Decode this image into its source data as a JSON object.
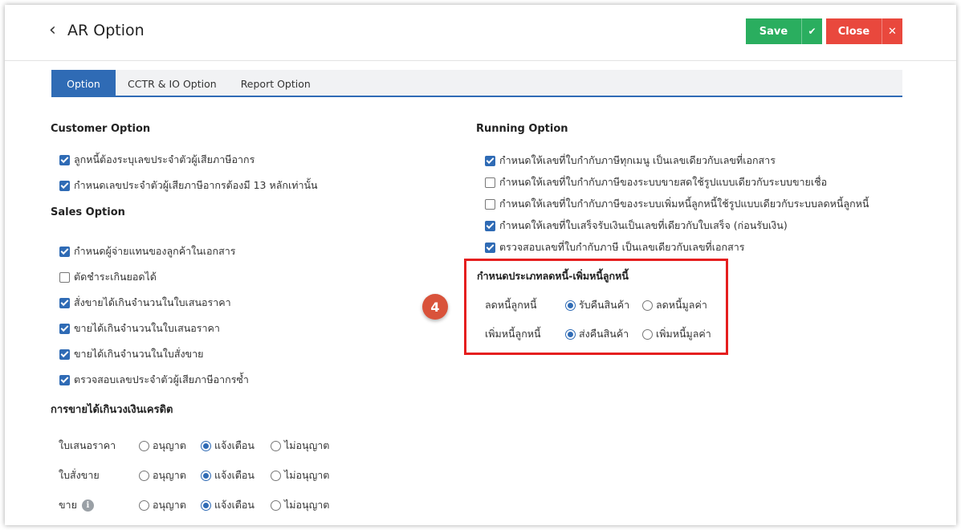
{
  "header": {
    "title": "AR Option",
    "save_label": "Save",
    "close_label": "Close"
  },
  "tabs": [
    "Option",
    "CCTR & IO Option",
    "Report Option"
  ],
  "customer_option": {
    "title": "Customer Option",
    "items": [
      {
        "label": "ลูกหนี้ต้องระบุเลขประจำตัวผู้เสียภาษีอากร",
        "checked": true
      },
      {
        "label": "กำหนดเลขประจำตัวผู้เสียภาษีอากรต้องมี 13 หลักเท่านั้น",
        "checked": true
      }
    ]
  },
  "sales_option": {
    "title": "Sales Option",
    "items": [
      {
        "label": "กำหนดผู้จ่ายแทนของลูกค้าในเอกสาร",
        "checked": true
      },
      {
        "label": "ตัดชำระเกินยอดได้",
        "checked": false
      },
      {
        "label": "สั่งขายได้เกินจำนวนในใบเสนอราคา",
        "checked": true
      },
      {
        "label": "ขายได้เกินจำนวนในใบเสนอราคา",
        "checked": true
      },
      {
        "label": "ขายได้เกินจำนวนในใบสั่งขาย",
        "checked": true
      },
      {
        "label": "ตรวจสอบเลขประจำตัวผู้เสียภาษีอากรซ้ำ",
        "checked": true
      }
    ]
  },
  "credit_limit": {
    "title": "การขายได้เกินวงเงินเครดิต",
    "options": [
      "อนุญาต",
      "แจ้งเตือน",
      "ไม่อนุญาต"
    ],
    "rows": [
      {
        "label": "ใบเสนอราคา",
        "selected": 1
      },
      {
        "label": "ใบสั่งขาย",
        "selected": 1
      },
      {
        "label": "ขาย",
        "selected": 1,
        "info_icon": "info-icon"
      }
    ]
  },
  "running_option": {
    "title": "Running Option",
    "items": [
      {
        "label": "กำหนดให้เลขที่ใบกำกับภาษีทุกเมนู เป็นเลขเดียวกับเลขที่เอกสาร",
        "checked": true
      },
      {
        "label": "กำหนดให้เลขที่ใบกำกับภาษีของระบบขายสดใช้รูปแบบเดียวกับระบบขายเชื่อ",
        "checked": false
      },
      {
        "label": "กำหนดให้เลขที่ใบกำกับภาษีของระบบเพิ่มหนี้ลูกหนี้ใช้รูปแบบเดียวกับระบบลดหนี้ลูกหนี้",
        "checked": false
      },
      {
        "label": "กำหนดให้เลขที่ใบเสร็จรับเงินเป็นเลขที่เดียวกับใบเสร็จ (ก่อนรับเงิน)",
        "checked": true
      },
      {
        "label": "ตรวจสอบเลขที่ใบกำกับภาษี เป็นเลขเดียวกับเลขที่เอกสาร",
        "checked": true
      }
    ]
  },
  "debt_type": {
    "title": "กำหนดประเภทลดหนี้-เพิ่มหนี้ลูกหนี้",
    "rows": [
      {
        "label": "ลดหนี้ลูกหนี้",
        "options": [
          "รับคืนสินค้า",
          "ลดหนี้มูลค่า"
        ],
        "selected": 0
      },
      {
        "label": "เพิ่มหนี้ลูกหนี้",
        "options": [
          "ส่งคืนสินค้า",
          "เพิ่มหนี้มูลค่า"
        ],
        "selected": 0
      }
    ]
  },
  "step_badge": "4",
  "colors": {
    "primary": "#2f6bb5",
    "save": "#2aae5f",
    "close": "#e9483d",
    "highlight": "#e51f1f",
    "badge": "#d9533b"
  }
}
